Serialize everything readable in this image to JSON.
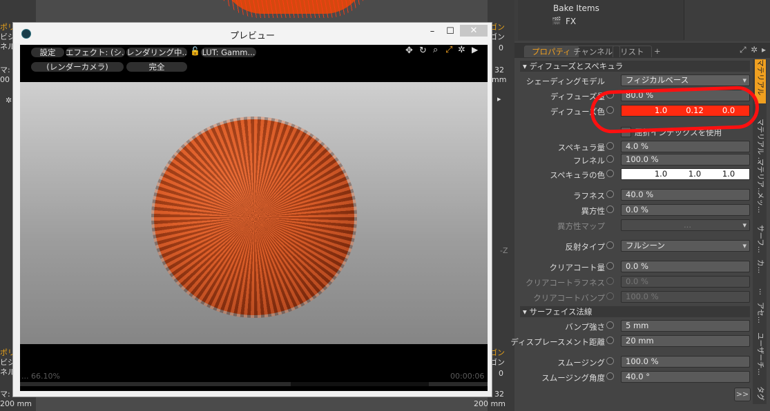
{
  "viewport_left_top": [
    "ポリ",
    "ビジ",
    "ネル",
    "マ: 8.",
    "00"
  ],
  "viewport_left_bottom": [
    "ポリ",
    "ビジ",
    "ネル",
    "マ: 8.",
    "200 mm"
  ],
  "viewport_right_top": [
    "ゴン",
    "ゴン",
    "0",
    "32",
    "mm"
  ],
  "viewport_right_bottom": [
    "ゴン",
    "ゴン",
    "0",
    "32",
    "200 mm"
  ],
  "viewport_axis": "-Z",
  "preview": {
    "title": "プレビュー",
    "minimize": "–",
    "maximize": "☐",
    "close": "✕",
    "toolbar": {
      "settings": "設定",
      "effect": "エフェクト: (シ...",
      "rendering": "レンダリング中...",
      "lut": "LUT: Gamm...",
      "camera": "(レンダーカメラ)",
      "complete": "完全"
    },
    "status_left": "... 66.10%",
    "status_right": "00:00:06"
  },
  "tree": {
    "bake_items": "Bake Items",
    "fx": "FX"
  },
  "tabs": [
    "プロパティ",
    "チャンネル",
    "リスト",
    "+"
  ],
  "sections": {
    "diffuse_specular": "ディフューズとスペキュラ",
    "surface_normal": "サーフェイス法線"
  },
  "props": {
    "shading_model": {
      "label": "シェーディングモデル",
      "value": "フィジカルベース"
    },
    "diffuse_amount": {
      "label": "ディフューズ量",
      "value": "80.0 %"
    },
    "diffuse_color": {
      "label": "ディフューズ色",
      "r": "1.0",
      "g": "0.12",
      "b": "0.0",
      "color": "#ff2a10"
    },
    "refraction_index": {
      "label": "屈折インデックスを使用"
    },
    "specular_amount": {
      "label": "スペキュラ量",
      "value": "4.0 %"
    },
    "fresnel": {
      "label": "フレネル",
      "value": "100.0 %"
    },
    "specular_color": {
      "label": "スペキュラの色",
      "r": "1.0",
      "g": "1.0",
      "b": "1.0"
    },
    "roughness": {
      "label": "ラフネス",
      "value": "40.0 %"
    },
    "anisotropy": {
      "label": "異方性",
      "value": "0.0 %"
    },
    "anisotropy_map": {
      "label": "異方性マップ",
      "value": "..."
    },
    "reflection_type": {
      "label": "反射タイプ",
      "value": "フルシーン"
    },
    "clearcoat_amount": {
      "label": "クリアコート量",
      "value": "0.0 %"
    },
    "clearcoat_roughness": {
      "label": "クリアコートラフネス",
      "value": "0.0 %"
    },
    "clearcoat_bump": {
      "label": "クリアコートバンプ",
      "value": "100.0 %"
    },
    "bump_strength": {
      "label": "バンプ強さ",
      "value": "5 mm"
    },
    "displacement_distance": {
      "label": "ディスプレースメント距離",
      "value": "20 mm"
    },
    "smoothing": {
      "label": "スムージング",
      "value": "100.0 %"
    },
    "smoothing_angle": {
      "label": "スムージング角度",
      "value": "40.0 °"
    }
  },
  "vertical_tabs": [
    "マテリアル",
    "マテリアル ...",
    "マテリア...",
    "メッ...",
    "サーフ...",
    "カ...",
    "...",
    "アセ...",
    "ユーザーチ...",
    "タグ"
  ],
  "expand_button": ">>",
  "colors": {
    "accent": "#f0a020",
    "highlight_ring": "#ff1010"
  }
}
